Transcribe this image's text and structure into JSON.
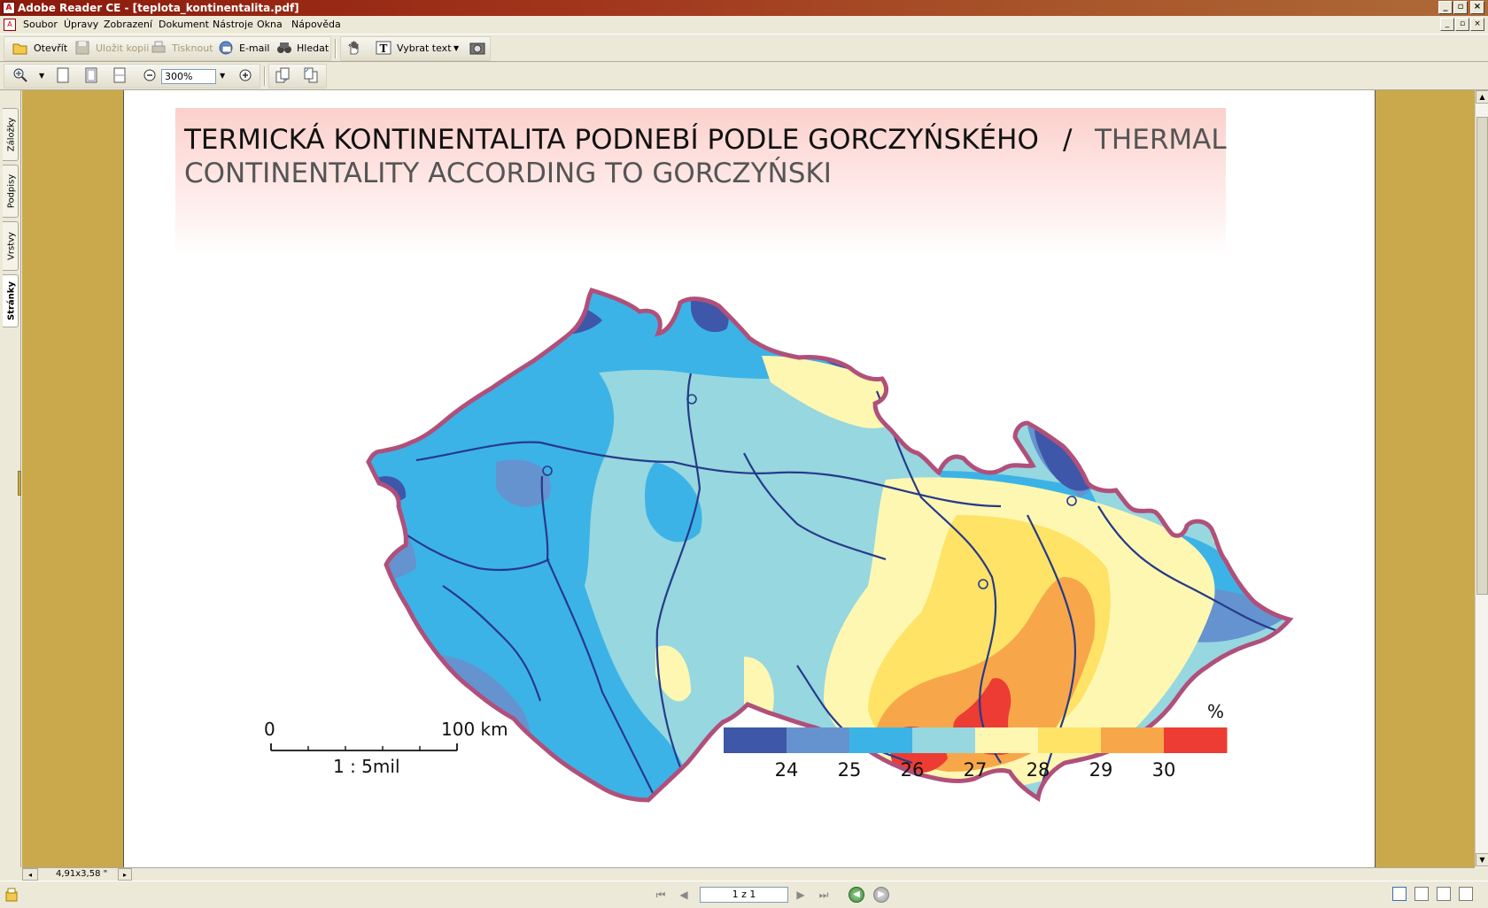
{
  "window": {
    "title": "Adobe Reader CE - [teplota_kontinentalita.pdf]"
  },
  "menu": {
    "items": [
      "Soubor",
      "Úpravy",
      "Zobrazení",
      "Dokument",
      "Nástroje",
      "Okna",
      "Nápověda"
    ]
  },
  "toolbar": {
    "open": "Otevřít",
    "save_copy": "Uložit kopii",
    "print": "Tisknout",
    "email": "E-mail",
    "search": "Hledat",
    "select_text": "Vybrat text",
    "zoom": "300%"
  },
  "left_tabs": [
    "Záložky",
    "Podpisy",
    "Vrstvy",
    "Stránky"
  ],
  "map": {
    "title_cz": "TERMICKÁ KONTINENTALITA PODNEBÍ PODLE GORCZYŃSKÉHO",
    "title_sep": "/",
    "title_en_1": "THERMAL",
    "title_en_2": "CONTINENTALITY ACCORDING TO GORCZYŃSKI",
    "scale_zero": "0",
    "scale_max": "100 km",
    "scale_ratio": "1 : 5mil",
    "legend_unit": "%",
    "legend_colors": [
      "#3f57a8",
      "#6593cf",
      "#3cb3e6",
      "#97d7df",
      "#fdf7b2",
      "#fee366",
      "#f7a74a",
      "#ec3c33"
    ],
    "legend_values": [
      "24",
      "25",
      "26",
      "27",
      "28",
      "29",
      "30"
    ]
  },
  "status": {
    "page_size": "4,91x3,58 \"",
    "page_number": "1 z 1"
  },
  "colors": {
    "titlebar": "#8a1a0c",
    "doc_bg": "#c9a94c",
    "border": "#b0507a"
  }
}
